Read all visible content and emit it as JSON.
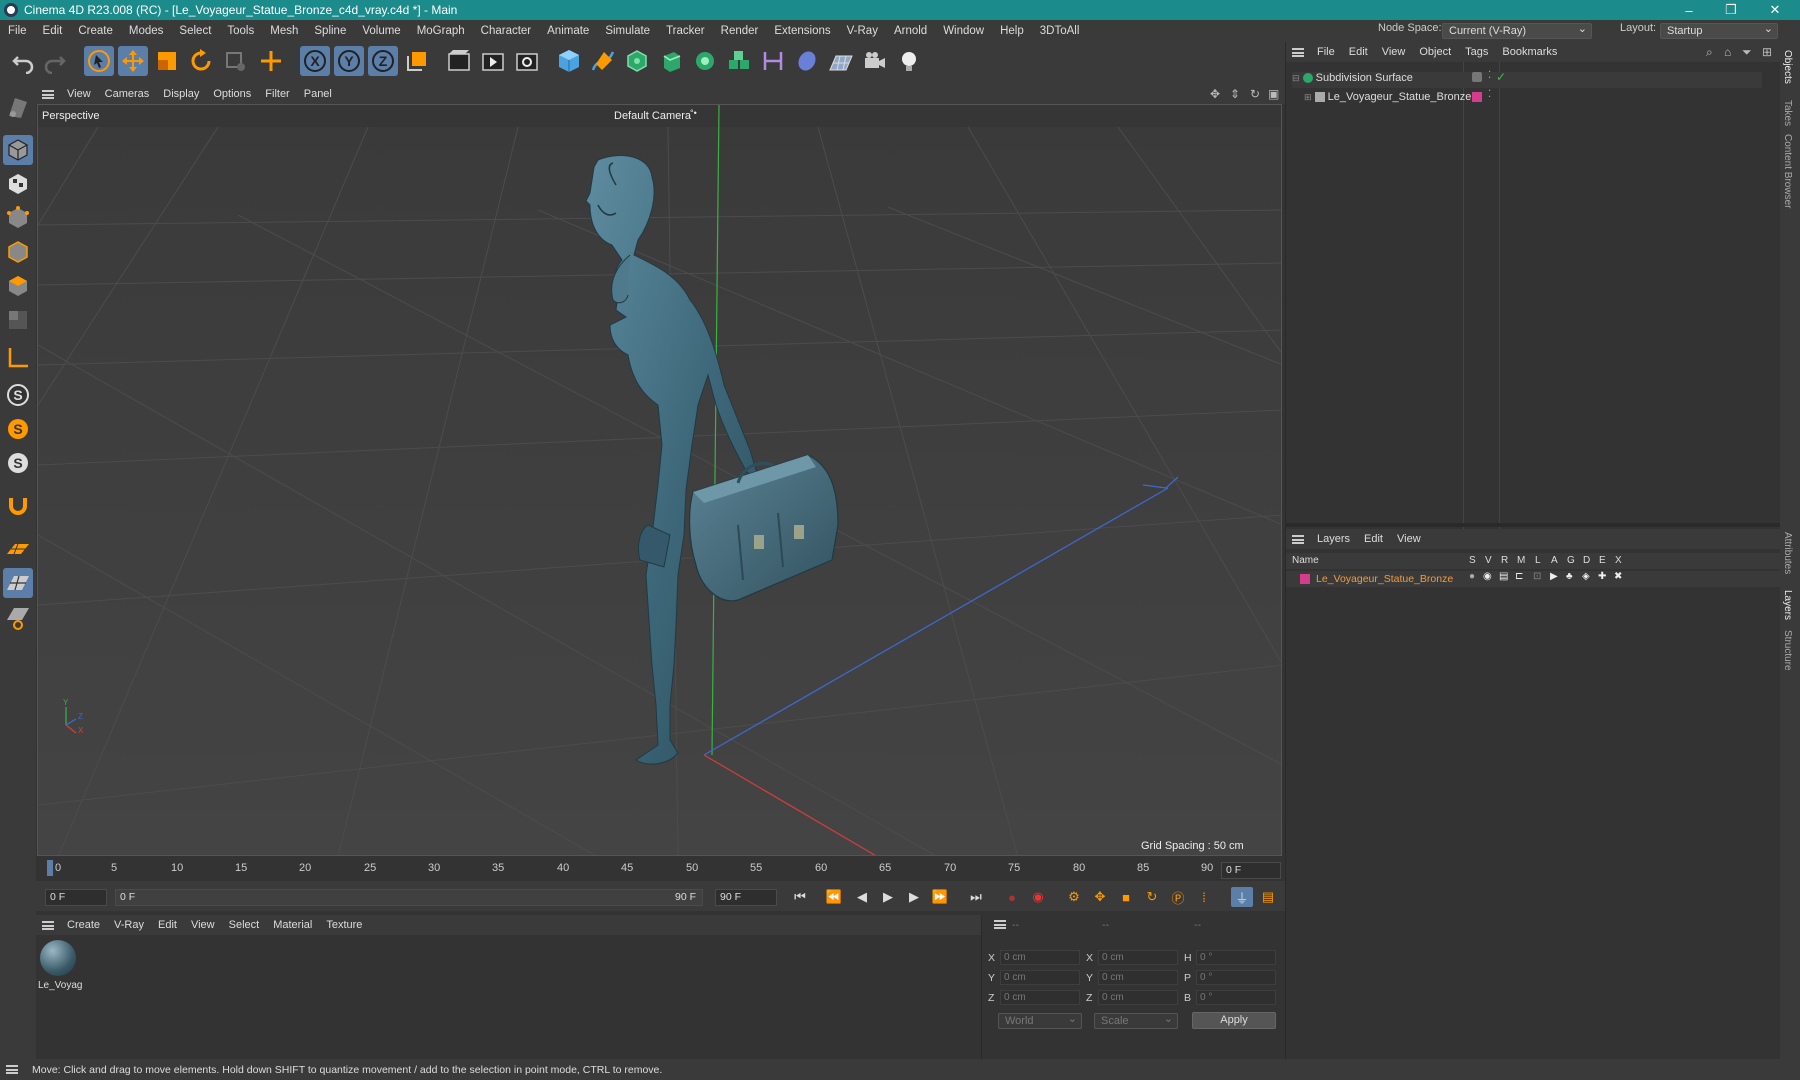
{
  "window": {
    "title": "Cinema 4D R23.008 (RC) - [Le_Voyageur_Statue_Bronze_c4d_vray.c4d *] - Main",
    "minimize": "–",
    "maximize": "❐",
    "close": "✕"
  },
  "menubar": {
    "items": [
      "File",
      "Edit",
      "Create",
      "Modes",
      "Select",
      "Tools",
      "Mesh",
      "Spline",
      "Volume",
      "MoGraph",
      "Character",
      "Animate",
      "Simulate",
      "Tracker",
      "Render",
      "Extensions",
      "V-Ray",
      "Arnold",
      "Window",
      "Help",
      "3DToAll"
    ],
    "node_space_label": "Node Space:",
    "node_space_value": "Current (V-Ray)",
    "layout_label": "Layout:",
    "layout_value": "Startup"
  },
  "toolbar": {
    "axis_x": "X",
    "axis_y": "Y",
    "axis_z": "Z"
  },
  "left_toolbar": {
    "s1": "S",
    "s2": "S",
    "s3": "S"
  },
  "viewport": {
    "menu": [
      "View",
      "Cameras",
      "Display",
      "Options",
      "Filter",
      "Panel"
    ],
    "view_name": "Perspective",
    "camera": "Default Camera",
    "camera_suffix": "°•",
    "grid_spacing": "Grid Spacing : 50 cm",
    "axis_y": "Y",
    "axis_z": "Z",
    "axis_x": "X"
  },
  "timeline": {
    "ticks": [
      "0",
      "5",
      "10",
      "15",
      "20",
      "25",
      "30",
      "35",
      "40",
      "45",
      "50",
      "55",
      "60",
      "65",
      "70",
      "75",
      "80",
      "85",
      "90"
    ],
    "current_frame": "0 F",
    "start_frame": "0 F",
    "range_start": "0 F",
    "range_end": "90 F",
    "end_frame": "90 F"
  },
  "material_manager": {
    "menu": [
      "Create",
      "V-Ray",
      "Edit",
      "View",
      "Select",
      "Material",
      "Texture"
    ],
    "material_name": "Le_Voyag"
  },
  "coordinates": {
    "header": [
      "--",
      "--",
      "--"
    ],
    "rows": [
      {
        "l1": "X",
        "v1": "0 cm",
        "l2": "X",
        "v2": "0 cm",
        "l3": "H",
        "v3": "0 °"
      },
      {
        "l1": "Y",
        "v1": "0 cm",
        "l2": "Y",
        "v2": "0 cm",
        "l3": "P",
        "v3": "0 °"
      },
      {
        "l1": "Z",
        "v1": "0 cm",
        "l2": "Z",
        "v2": "0 cm",
        "l3": "B",
        "v3": "0 °"
      }
    ],
    "space": "World",
    "mode": "Scale",
    "apply": "Apply"
  },
  "object_manager": {
    "menu": [
      "File",
      "Edit",
      "View",
      "Object",
      "Tags",
      "Bookmarks"
    ],
    "objects": [
      "Subdivision Surface",
      "Le_Voyageur_Statue_Bronze"
    ]
  },
  "layer_manager": {
    "menu": [
      "Layers",
      "Edit",
      "View"
    ],
    "col_name": "Name",
    "cols": [
      "S",
      "V",
      "R",
      "M",
      "L",
      "A",
      "G",
      "D",
      "E",
      "X"
    ],
    "layer_name": "Le_Voyageur_Statue_Bronze",
    "layer_color": "#d63c8c"
  },
  "side_tabs": [
    "Objects",
    "Takes",
    "Content Browser",
    "Attributes",
    "Layers",
    "Structure"
  ],
  "status": "Move: Click and drag to move elements. Hold down SHIFT to quantize movement / add to the selection in point mode, CTRL to remove.",
  "colors": {
    "titlebar": "#1c8b8b",
    "accent": "#ff8c00",
    "tool_highlight": "#5b7fa8"
  }
}
